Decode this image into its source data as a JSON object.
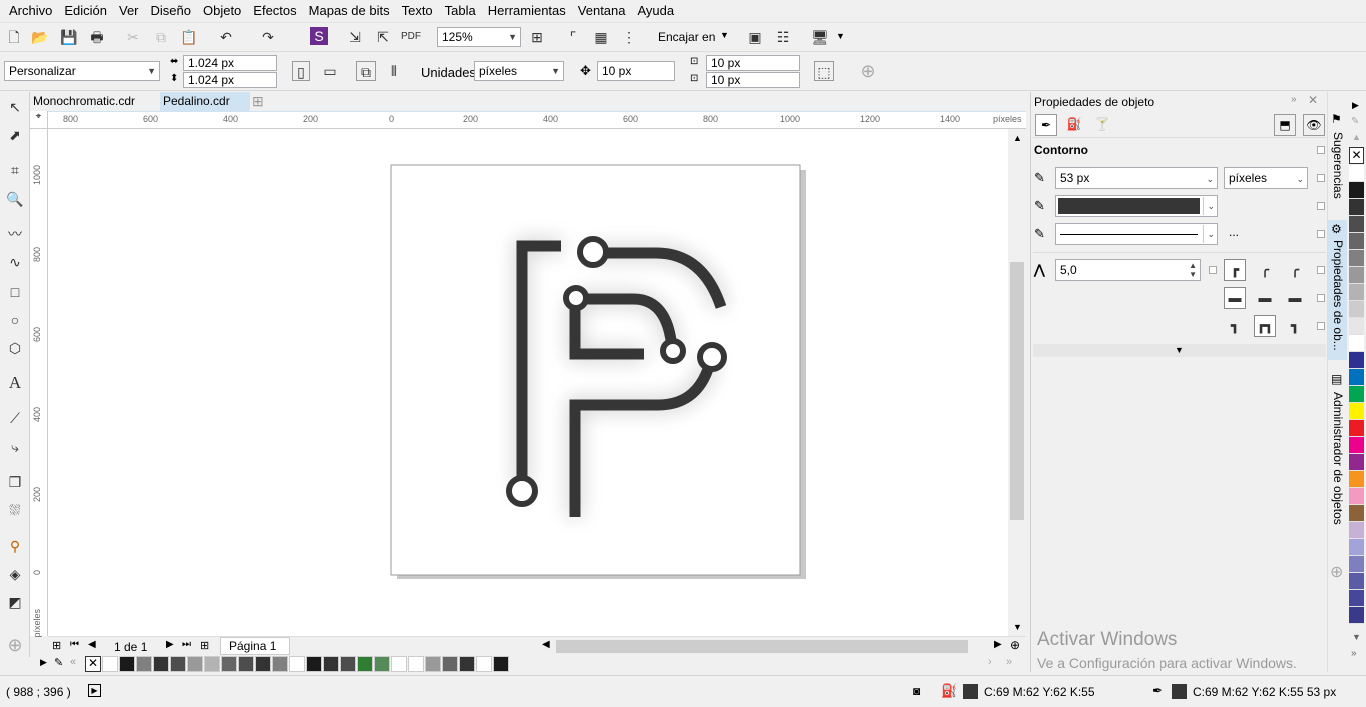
{
  "menu": [
    "Archivo",
    "Edición",
    "Ver",
    "Diseño",
    "Objeto",
    "Efectos",
    "Mapas de bits",
    "Texto",
    "Tabla",
    "Herramientas",
    "Ventana",
    "Ayuda"
  ],
  "toolbar": {
    "zoom": "125%",
    "snap": "Encajar en"
  },
  "propbar": {
    "preset": "Personalizar",
    "width": "1.024 px",
    "height": "1.024 px",
    "units_label": "Unidades:",
    "units": "píxeles",
    "nudge": "10 px",
    "dup_x": "10 px",
    "dup_y": "10 px"
  },
  "tabs": [
    "Monochromatic.cdr",
    "Pedalino.cdr"
  ],
  "ruler": {
    "h_ticks": [
      "800",
      "600",
      "400",
      "200",
      "0",
      "200",
      "400",
      "600",
      "800",
      "1000",
      "1200",
      "1400"
    ],
    "h_unit": "píxeles",
    "v_ticks": [
      "1000",
      "800",
      "600",
      "400",
      "200",
      "0"
    ],
    "v_unit": "píxeles"
  },
  "pagebar": {
    "counter": "1 de 1",
    "page": "Página 1"
  },
  "docker": {
    "title": "Propiedades de objeto",
    "section": "Contorno",
    "width": "53 px",
    "units": "píxeles",
    "more": "...",
    "miter": "5,0"
  },
  "dockertabs": [
    "Sugerencias",
    "Propiedades de ob...",
    "Administrador de objetos"
  ],
  "watermark": {
    "line1": "Activar Windows",
    "line2": "Ve a Configuración para activar Windows."
  },
  "status": {
    "coords": "( 988  ; 396   )",
    "fill": "C:69 M:62 Y:62 K:55",
    "outline": "C:69 M:62 Y:62 K:55  53 px"
  },
  "colors": {
    "object": "#363636",
    "accent": "#cfe3f3"
  },
  "palette_colors": [
    "#ffffff",
    "#1a1a1a",
    "#333333",
    "#4d4d4d",
    "#666666",
    "#808080",
    "#999999",
    "#b3b3b3",
    "#cccccc",
    "#e6e6e6",
    "#ffffff",
    "#2e3192",
    "#0071bc",
    "#00a651",
    "#fff200",
    "#ed1c24",
    "#ec008c",
    "#92278f",
    "#f7941d",
    "#f49ac1",
    "#8c6239",
    "#c7b2d6",
    "#a3a3d9",
    "#7f7fbf",
    "#5c5ca6",
    "#46469b",
    "#3a3a8a"
  ],
  "doc_palette_colors": [
    "#ffffff",
    "#1a1a1a",
    "#808080",
    "#333333",
    "#4d4d4d",
    "#999999",
    "#b3b3b3",
    "#666666",
    "#4d4d4d",
    "#333333",
    "#808080",
    "#ffffff",
    "#1a1a1a",
    "#333333",
    "#4d4d4d",
    "#2e7d32",
    "#558b5a",
    "#ffffff",
    "#ffffff",
    "#999999",
    "#666666",
    "#333333",
    "#ffffff",
    "#1a1a1a"
  ]
}
